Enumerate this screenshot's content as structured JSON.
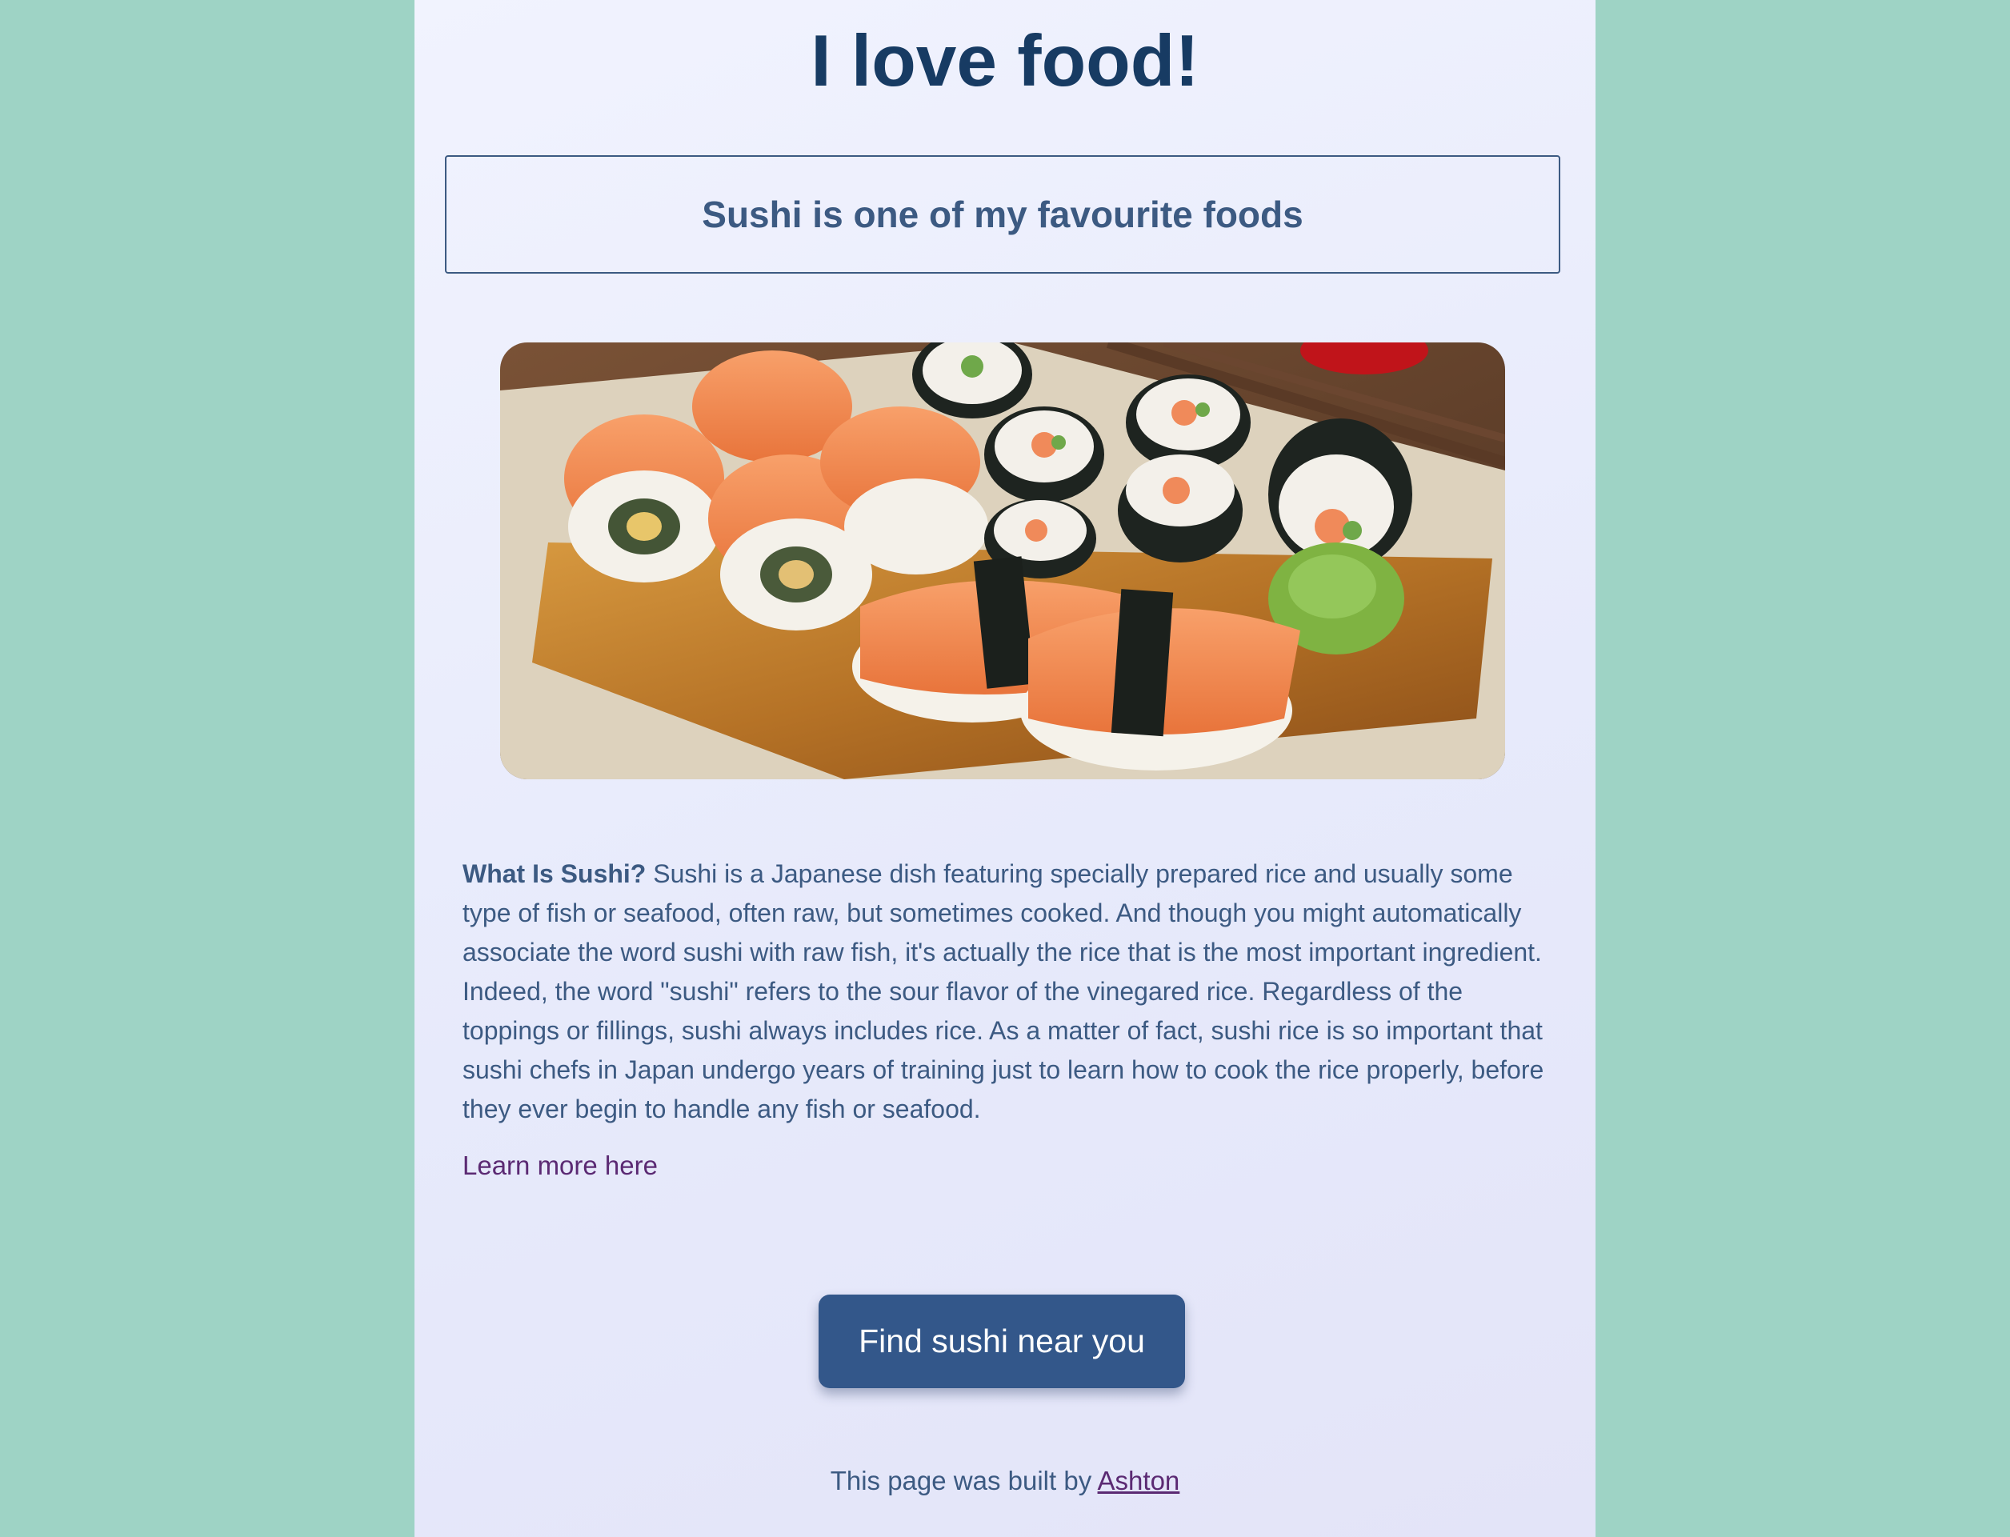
{
  "page": {
    "title": "I love food!",
    "subtitle": "Sushi is one of my favourite foods",
    "image_alt": "Sushi rolls and nigiri on a wooden board",
    "description": {
      "lead": "What Is Sushi?",
      "body": " Sushi is a Japanese dish featuring specially prepared rice and usually some type of fish or seafood, often raw, but sometimes cooked. And though you might automatically associate the word sushi with raw fish, it's actually the rice that is the most important ingredient. Indeed, the word \"sushi\" refers to the sour flavor of the vinegared rice. Regardless of the toppings or fillings, sushi always includes rice. As a matter of fact, sushi rice is so important that sushi chefs in Japan undergo years of training just to learn how to cook the rice properly, before they ever begin to handle any fish or seafood."
    },
    "learn_more_label": "Learn more here",
    "cta_label": "Find sushi near you",
    "footer": {
      "text": "This page was built by ",
      "author": "Ashton"
    }
  },
  "colors": {
    "background": "#9ed3c5",
    "title": "#173b63",
    "text": "#3c5a82",
    "link": "#5b2a73",
    "button": "#33578a"
  }
}
